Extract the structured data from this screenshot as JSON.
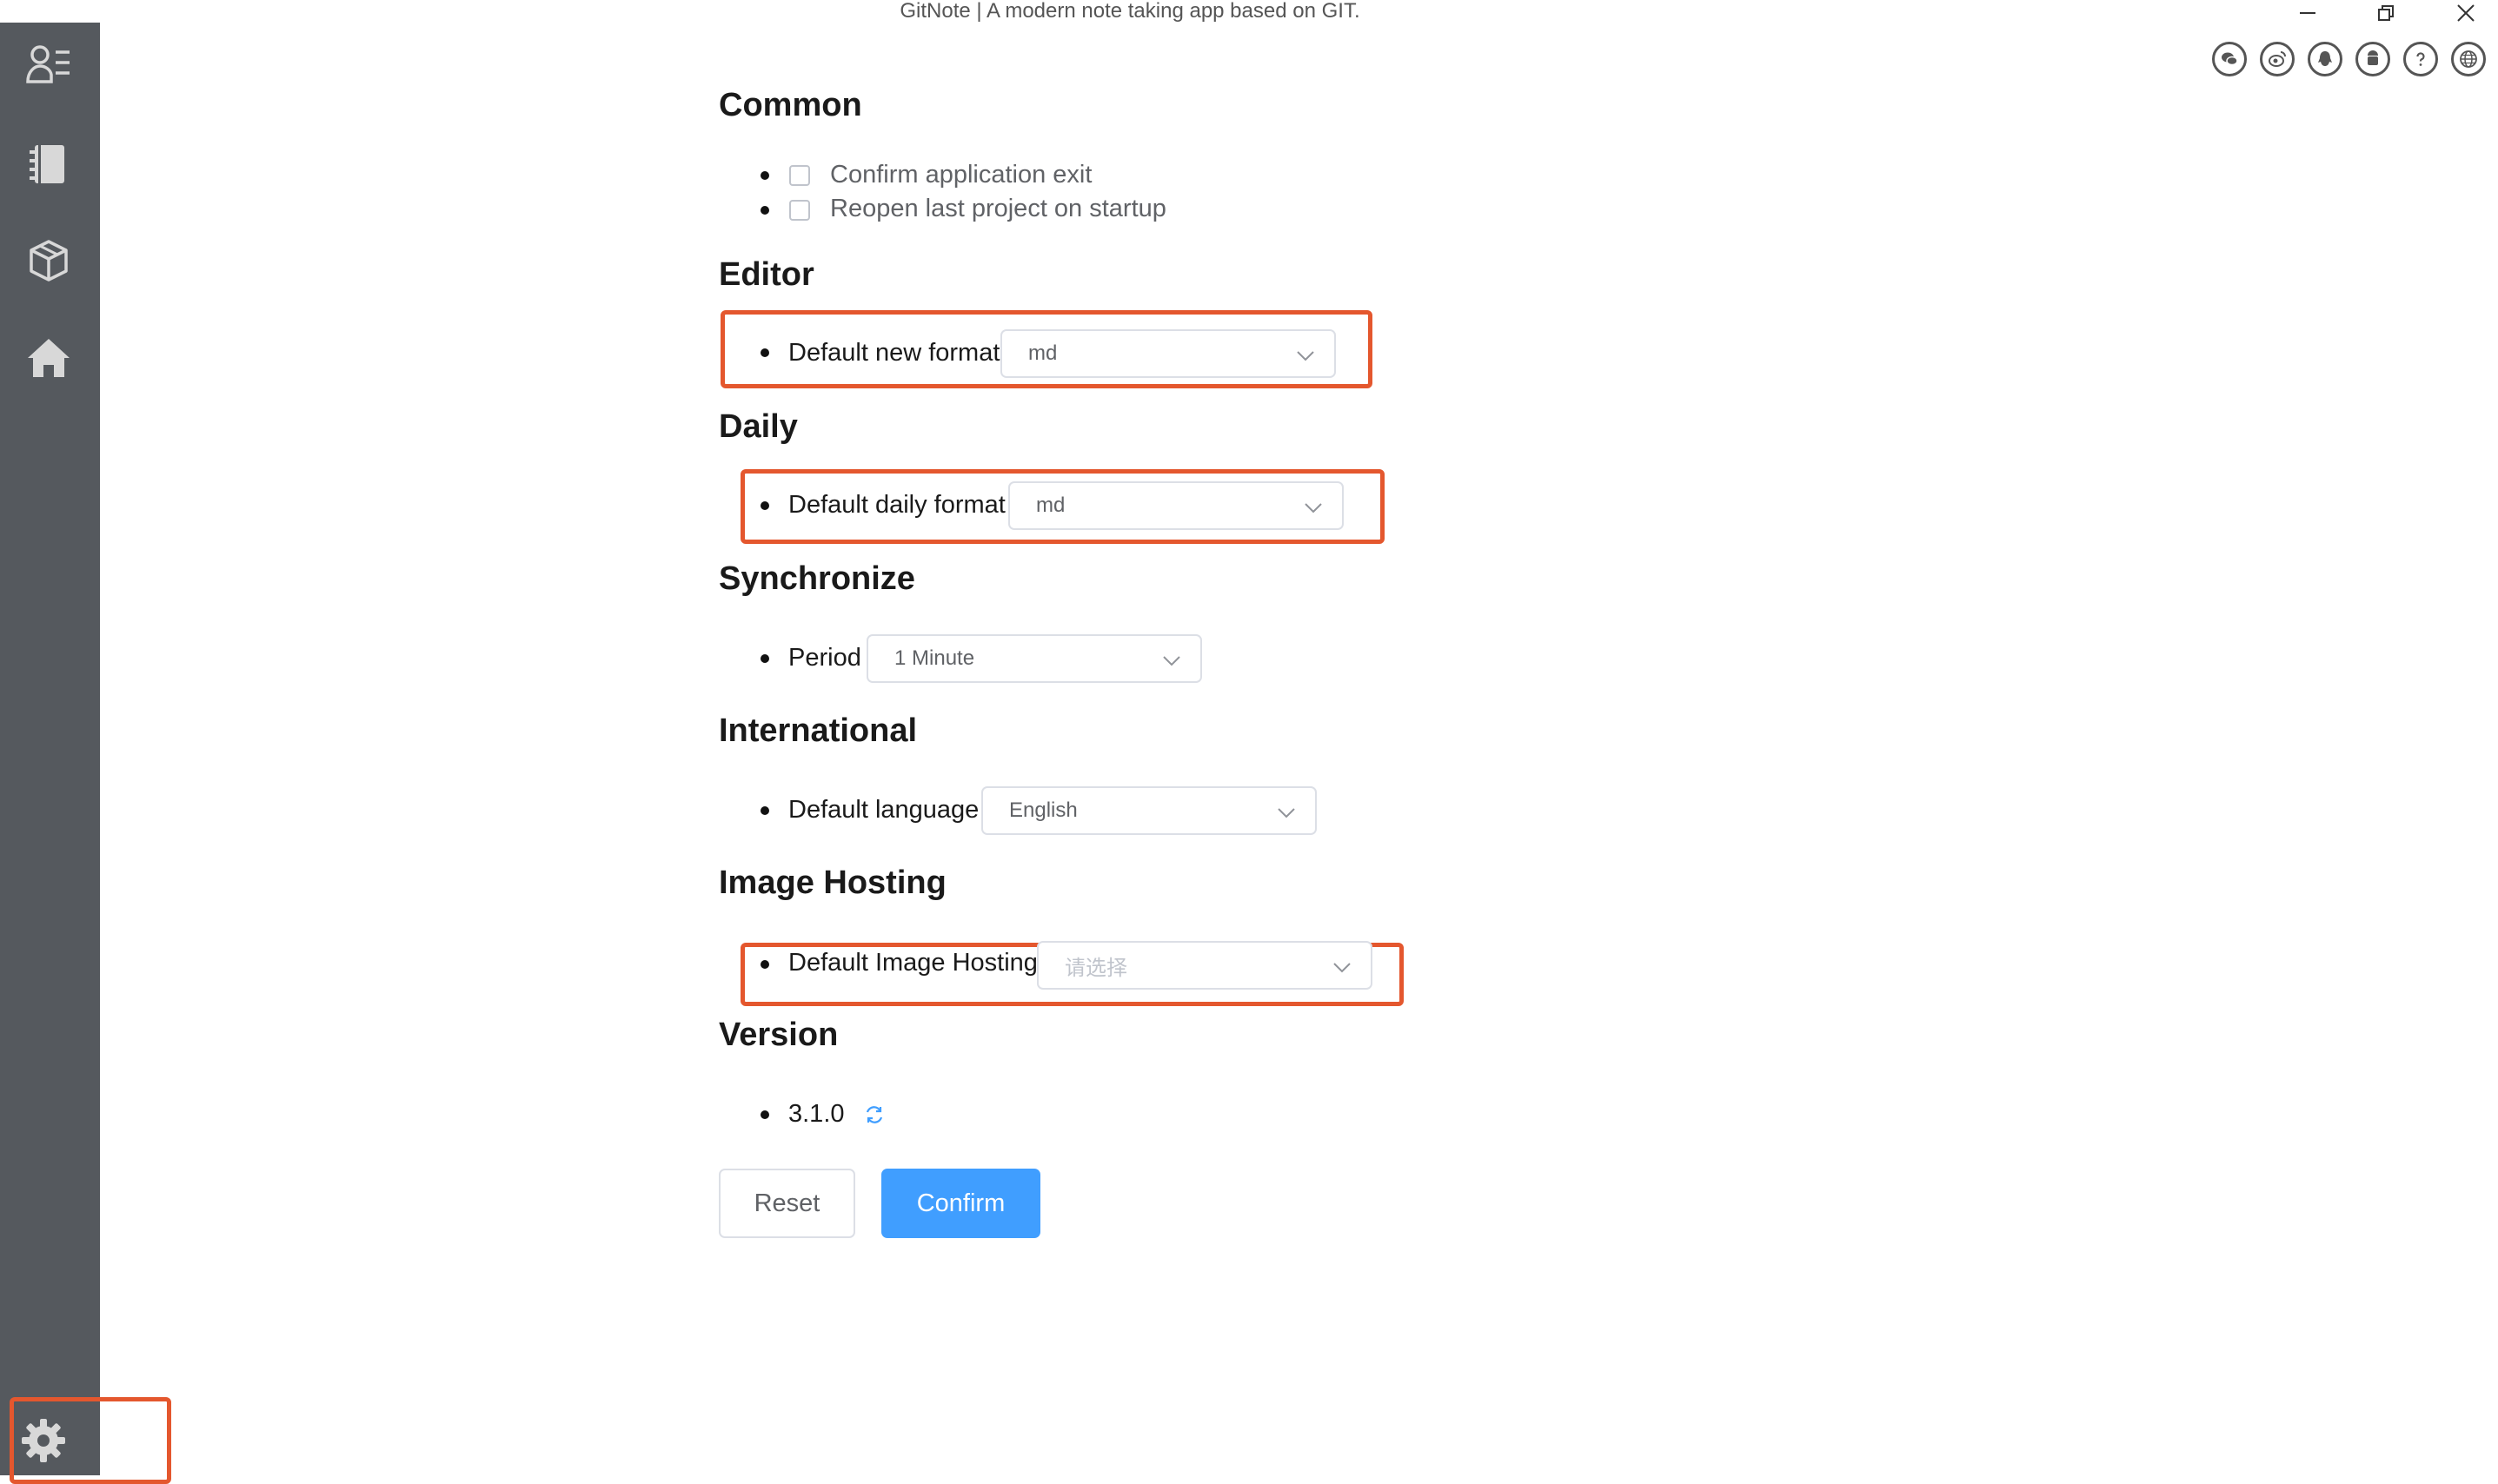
{
  "window": {
    "title": "GitNote | A modern note taking app based on GIT.",
    "controls": [
      "minimize-icon",
      "restore-icon",
      "close-icon"
    ]
  },
  "toolbar_icons": [
    "wechat-icon",
    "weibo-icon",
    "qq-icon",
    "android-icon",
    "help-icon",
    "globe-icon"
  ],
  "sidebar": {
    "items": [
      "user-list-icon",
      "notebook-icon",
      "package-icon",
      "home-icon"
    ],
    "bottom": "settings-gear-icon"
  },
  "common": {
    "title": "Common",
    "confirm_exit": "Confirm application exit",
    "reopen_last": "Reopen last project on startup"
  },
  "editor": {
    "title": "Editor",
    "default_format_label": "Default new format",
    "default_format_value": "md"
  },
  "daily": {
    "title": "Daily",
    "default_format_label": "Default daily format",
    "default_format_value": "md"
  },
  "sync": {
    "title": "Synchronize",
    "period_label": "Period",
    "period_value": "1 Minute"
  },
  "international": {
    "title": "International",
    "language_label": "Default language",
    "language_value": "English"
  },
  "image_hosting": {
    "title": "Image Hosting",
    "label": "Default Image Hosting",
    "placeholder": "请选择"
  },
  "version": {
    "title": "Version",
    "value": "3.1.0"
  },
  "actions": {
    "reset": "Reset",
    "confirm": "Confirm"
  },
  "colors": {
    "sidebar": "#55595e",
    "accent": "#409eff",
    "highlight": "#e4572e"
  }
}
